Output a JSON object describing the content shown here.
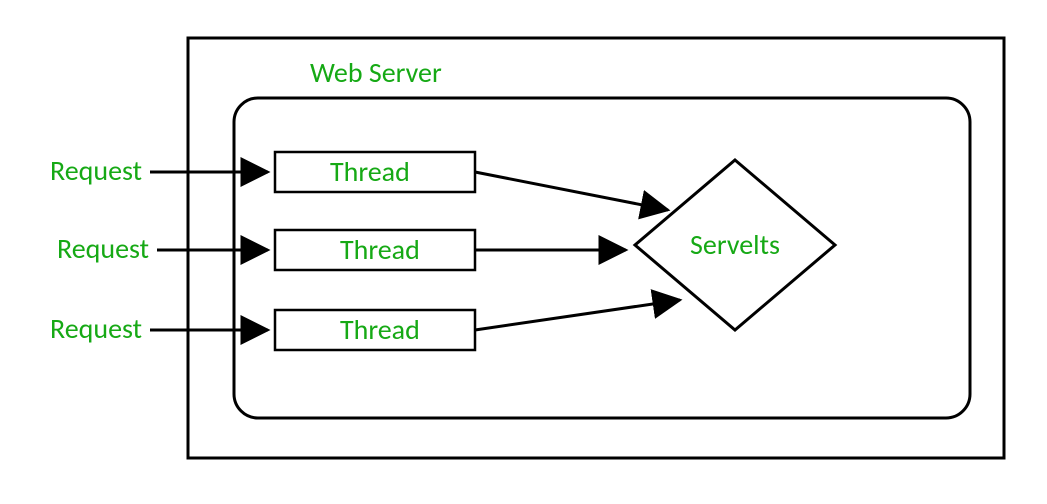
{
  "title": "Web Server",
  "requests": [
    {
      "label": "Request",
      "thread_label": "Thread"
    },
    {
      "label": "Request",
      "thread_label": "Thread"
    },
    {
      "label": "Request",
      "thread_label": "Thread"
    }
  ],
  "target": "Servelts",
  "colors": {
    "text": "#16a915",
    "stroke": "#000000"
  },
  "chart_data": {
    "type": "diagram",
    "description": "Three external requests each enter a web server, each mapped to its own Thread box, and all three threads point to a single Servlets node (diamond) inside the web server.",
    "nodes": [
      {
        "id": "req1",
        "label": "Request",
        "kind": "external"
      },
      {
        "id": "req2",
        "label": "Request",
        "kind": "external"
      },
      {
        "id": "req3",
        "label": "Request",
        "kind": "external"
      },
      {
        "id": "thr1",
        "label": "Thread",
        "kind": "thread"
      },
      {
        "id": "thr2",
        "label": "Thread",
        "kind": "thread"
      },
      {
        "id": "thr3",
        "label": "Thread",
        "kind": "thread"
      },
      {
        "id": "srv",
        "label": "Servelts",
        "kind": "servlet"
      }
    ],
    "edges": [
      {
        "from": "req1",
        "to": "thr1"
      },
      {
        "from": "req2",
        "to": "thr2"
      },
      {
        "from": "req3",
        "to": "thr3"
      },
      {
        "from": "thr1",
        "to": "srv"
      },
      {
        "from": "thr2",
        "to": "srv"
      },
      {
        "from": "thr3",
        "to": "srv"
      }
    ],
    "container": "Web Server"
  }
}
